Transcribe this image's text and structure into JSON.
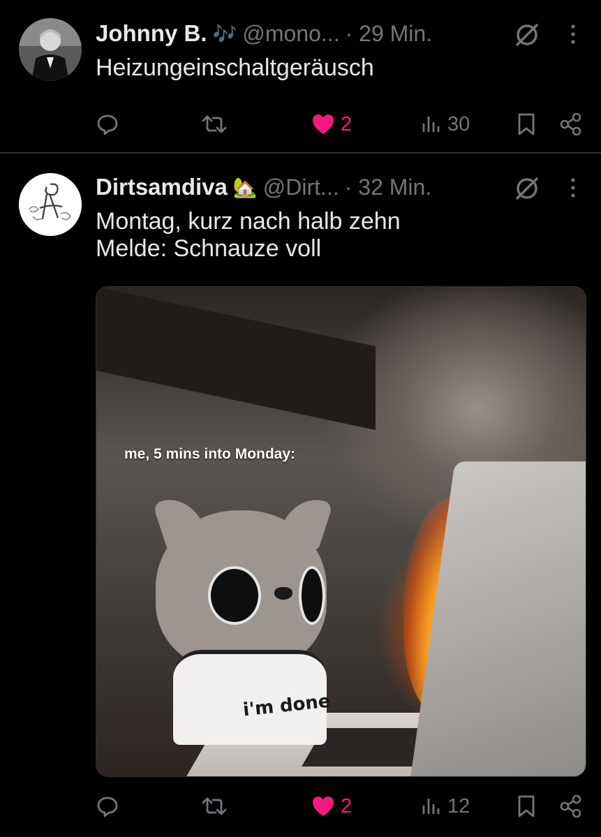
{
  "tweets": [
    {
      "name": "Johnny B.",
      "emoji": "🎶",
      "handle": "@mono...",
      "time": "· 29 Min.",
      "text": [
        "Heizungeinschaltgeräusch"
      ],
      "actions": {
        "replies": "",
        "reposts": "",
        "likes": "2",
        "views": "30"
      },
      "liked": true
    },
    {
      "name": "Dirtsamdiva",
      "emoji": "🏡",
      "handle": "@Dirt...",
      "time": "· 32 Min.",
      "text": [
        "Montag, kurz nach halb zehn",
        "Melde: Schnauze voll"
      ],
      "media": {
        "caption": "me, 5 mins into Monday:",
        "shirt_text": "i'm done"
      },
      "actions": {
        "replies": "",
        "reposts": "",
        "likes": "2",
        "views": "12"
      },
      "liked": true
    }
  ],
  "colors": {
    "background": "#000000",
    "text": "#e7e9ea",
    "muted": "#71767b",
    "like": "#f91880",
    "divider": "#2f3336"
  },
  "icons": [
    "reply-icon",
    "repost-icon",
    "heart-icon",
    "views-icon",
    "bookmark-icon",
    "share-icon",
    "grok-icon",
    "more-icon"
  ]
}
